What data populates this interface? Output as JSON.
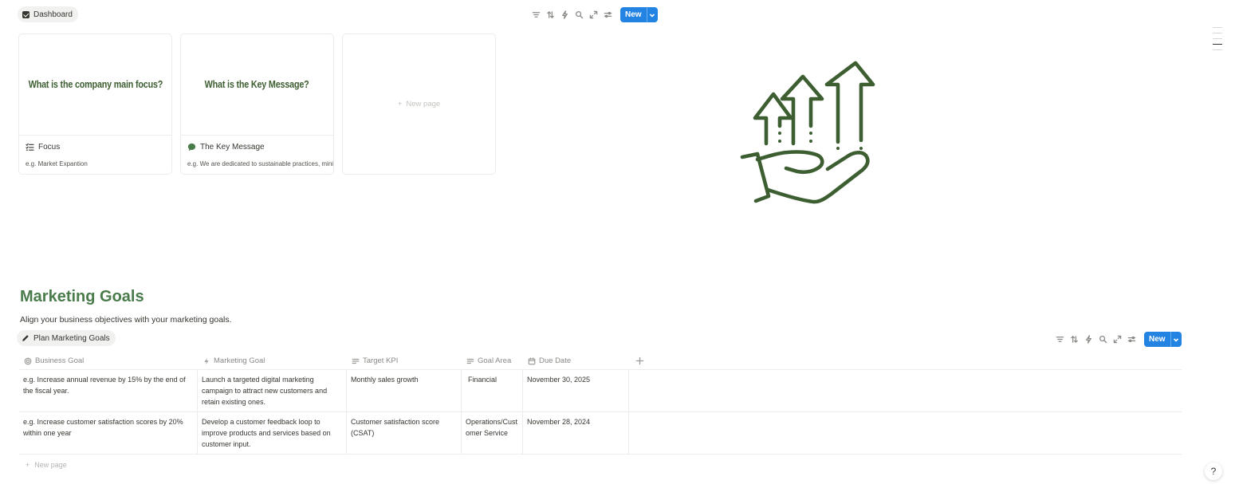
{
  "gallery": {
    "view_tab": "Dashboard",
    "new_label": "New",
    "cards": [
      {
        "cover_text": "What is the company main focus?",
        "title": "Focus",
        "property": "e.g. Market Expantion"
      },
      {
        "cover_text": "What is the Key Message?",
        "title": "The Key Message",
        "property": "e.g. We are dedicated to sustainable practices, minimizing our environmental impact."
      }
    ],
    "new_page": "New page"
  },
  "goals": {
    "heading": "Marketing Goals",
    "description": "Align your business objectives with your marketing goals.",
    "view_tab": "Plan Marketing Goals",
    "new_label": "New",
    "columns": [
      "Business Goal",
      "Marketing Goal",
      "Target KPI",
      "Goal Area",
      "Due Date"
    ],
    "rows": [
      [
        "e.g. Increase annual revenue by 15% by the end of the fiscal year.",
        "Launch a targeted digital marketing campaign to attract new customers and retain existing ones.",
        "Monthly sales growth",
        "Financial",
        "November 30, 2025"
      ],
      [
        "e.g. Increase customer satisfaction scores by 20% within one year",
        "Develop a customer feedback loop to improve products and services based on customer input.",
        "Customer satisfaction score (CSAT)",
        "Operations/Customer Service",
        "November 28, 2024"
      ]
    ],
    "new_page": "New page"
  },
  "help_label": "?",
  "colors": {
    "accent": "#2383e2",
    "heading_green": "#4a7c4b",
    "cover_green": "#3d5e31"
  }
}
